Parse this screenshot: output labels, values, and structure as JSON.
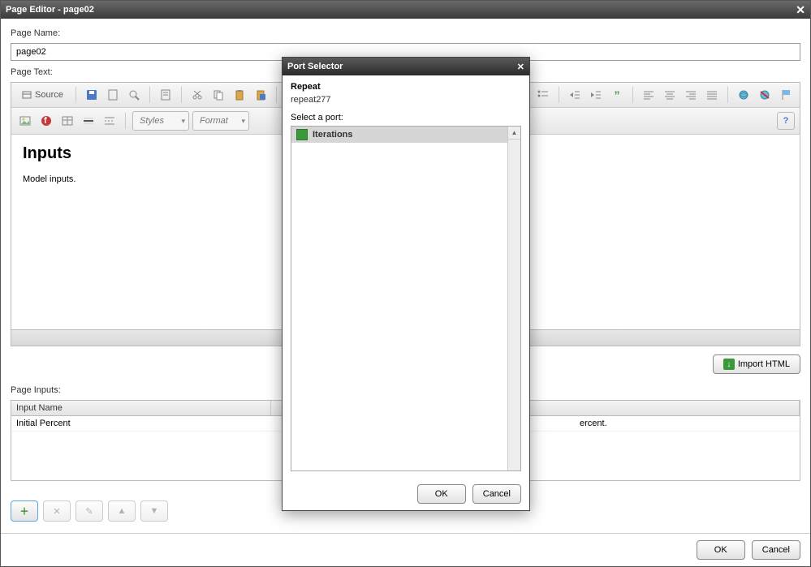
{
  "window": {
    "title": "Page Editor - page02"
  },
  "labels": {
    "page_name": "Page Name:",
    "page_text": "Page Text:",
    "page_inputs": "Page Inputs:"
  },
  "fields": {
    "page_name_value": "page02"
  },
  "toolbar": {
    "source": "Source",
    "styles_placeholder": "Styles",
    "format_placeholder": "Format"
  },
  "editor": {
    "heading": "Inputs",
    "body": "Model inputs."
  },
  "buttons": {
    "import_html": "Import HTML",
    "ok": "OK",
    "cancel": "Cancel"
  },
  "inputs_table": {
    "col_input_name": "Input Name",
    "rows": [
      {
        "name": "Initial Percent",
        "trailing": "ercent."
      }
    ]
  },
  "modal": {
    "title": "Port Selector",
    "header": "Repeat",
    "subheader": "repeat277",
    "select_label": "Select a port:",
    "ports": [
      "Iterations"
    ],
    "ok": "OK",
    "cancel": "Cancel"
  }
}
